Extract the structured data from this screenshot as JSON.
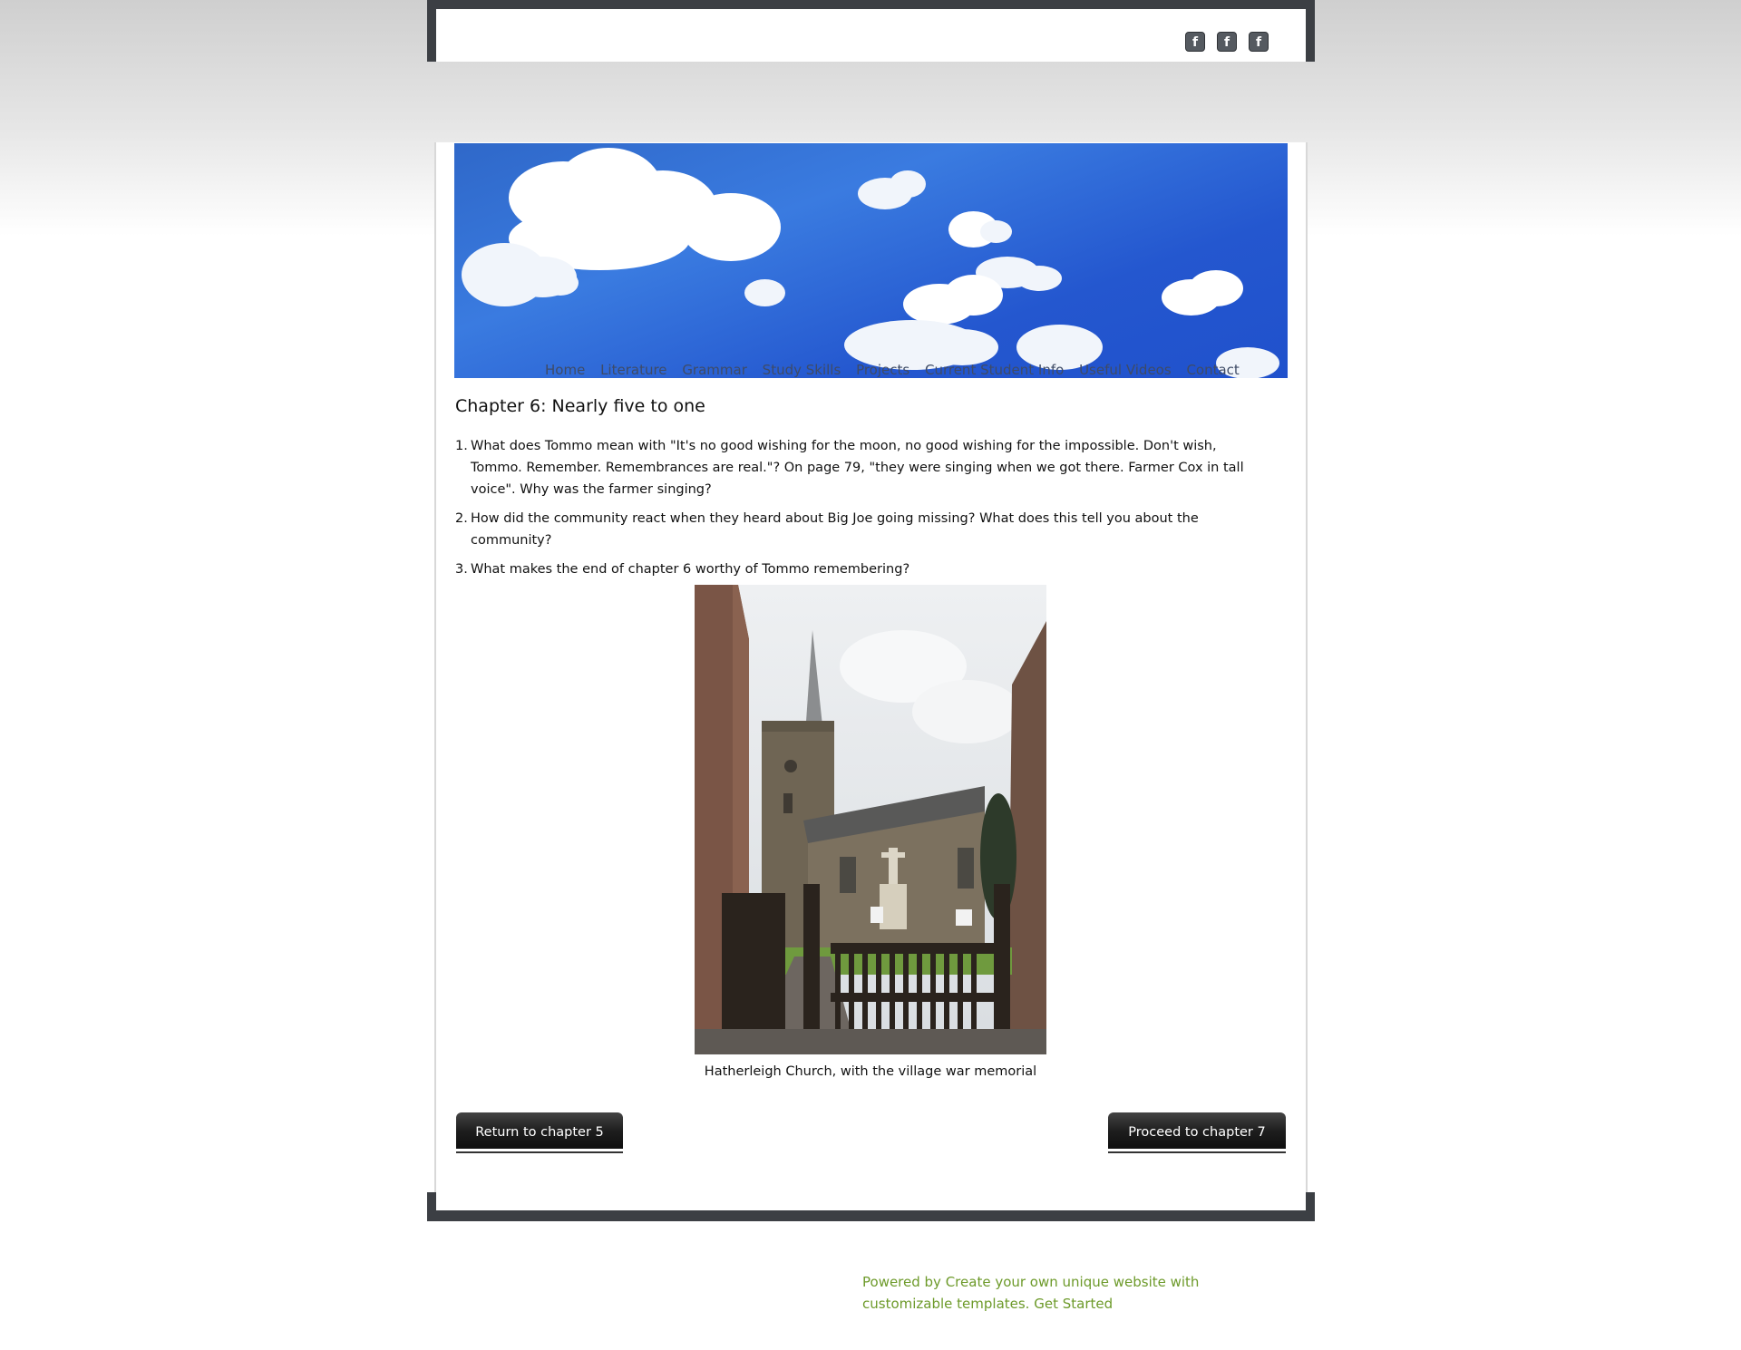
{
  "social": {
    "icons": [
      "facebook-icon",
      "facebook-icon",
      "facebook-icon"
    ],
    "glyph": "f"
  },
  "nav": {
    "items": [
      "Home",
      "Literature",
      "Grammar",
      "Study Skills",
      "Projects",
      "Current Student Info",
      "Useful Videos",
      "Contact"
    ]
  },
  "content": {
    "title": "Chapter 6: Nearly five to one",
    "questions": [
      {
        "num": "1.",
        "text": "What does Tommo mean with \"It's no good wishing for the moon, no good wishing for the impossible. Don't wish, Tommo. Remember. Remembrances are real.\"? On page 79, \"they were singing when we got there. Farmer Cox in tall voice\". Why was the farmer singing?"
      },
      {
        "num": "2.",
        "text": "How did the community react when they heard about Big Joe going missing? What does this tell you about the community?"
      },
      {
        "num": "3.",
        "text": "What makes the end of chapter 6 worthy of Tommo remembering?"
      }
    ],
    "caption": "Hatherleigh Church, with the village war memorial"
  },
  "buttons": {
    "prev": "Return to chapter 5",
    "next": "Proceed to chapter 7"
  },
  "footer": {
    "powered": "Powered by Create your own unique website with customizable templates. Get Started"
  },
  "colors": {
    "frame": "#3c3f44",
    "footer_link": "#6d9a2a",
    "nav_text": "#3e4b66"
  }
}
